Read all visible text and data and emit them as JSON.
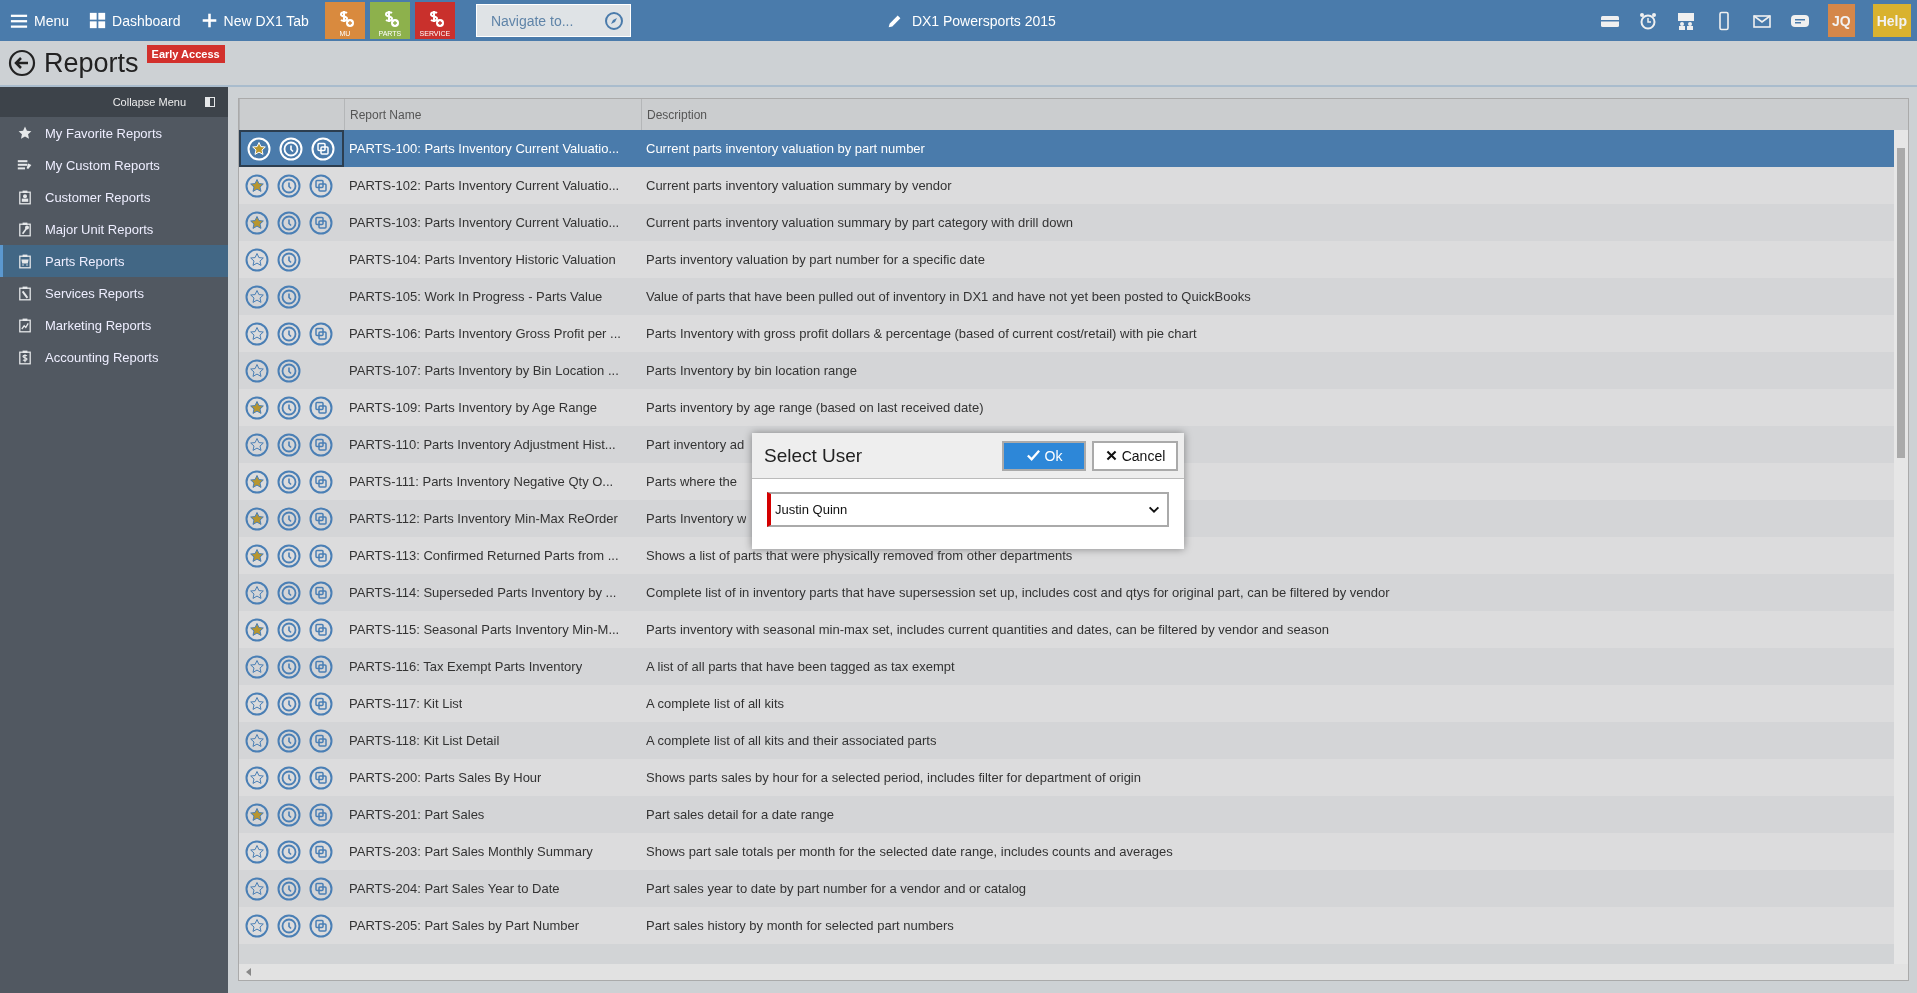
{
  "topbar": {
    "menu": "Menu",
    "dashboard": "Dashboard",
    "new_tab": "New DX1 Tab",
    "tiles": [
      {
        "label": "MU",
        "color": "#d98a3e"
      },
      {
        "label": "PARTS",
        "color": "#8db14c"
      },
      {
        "label": "SERVICE",
        "color": "#c9302c"
      }
    ],
    "navigate": {
      "placeholder": "Navigate to..."
    },
    "title": "DX1 Powersports 2015",
    "user": "JQ",
    "help": "Help"
  },
  "page": {
    "title": "Reports",
    "badge": "Early Access"
  },
  "sidebar": {
    "collapse": "Collapse Menu",
    "items": [
      {
        "label": "My Favorite Reports",
        "selected": false
      },
      {
        "label": "My Custom Reports",
        "selected": false
      },
      {
        "label": "Customer Reports",
        "selected": false
      },
      {
        "label": "Major Unit Reports",
        "selected": false
      },
      {
        "label": "Parts Reports",
        "selected": true
      },
      {
        "label": "Services Reports",
        "selected": false
      },
      {
        "label": "Marketing Reports",
        "selected": false
      },
      {
        "label": "Accounting Reports",
        "selected": false
      }
    ]
  },
  "table": {
    "columns": [
      "Report Name",
      "Description"
    ],
    "rows": [
      {
        "name": "PARTS-100: Parts Inventory Current Valuatio...",
        "description": "Current parts inventory valuation by part number",
        "favorite": true,
        "copy": true,
        "selected": true
      },
      {
        "name": "PARTS-102: Parts Inventory Current Valuatio...",
        "description": "Current parts inventory valuation summary by vendor",
        "favorite": true,
        "copy": true,
        "selected": false
      },
      {
        "name": "PARTS-103: Parts Inventory Current Valuatio...",
        "description": "Current parts inventory valuation summary by part category with drill down",
        "favorite": true,
        "copy": true,
        "selected": false
      },
      {
        "name": "PARTS-104: Parts Inventory Historic Valuation",
        "description": "Parts inventory valuation by part number for a specific date",
        "favorite": false,
        "copy": false,
        "selected": false
      },
      {
        "name": "PARTS-105: Work In Progress - Parts Value",
        "description": "Value of parts that have been pulled out of inventory in DX1 and have not yet been posted to QuickBooks",
        "favorite": false,
        "copy": false,
        "selected": false
      },
      {
        "name": "PARTS-106: Parts Inventory Gross Profit per ...",
        "description": "Parts Inventory with gross profit dollars & percentage (based of current cost/retail) with pie chart",
        "favorite": false,
        "copy": true,
        "selected": false
      },
      {
        "name": "PARTS-107: Parts Inventory by Bin Location ...",
        "description": "Parts Inventory by bin location range",
        "favorite": false,
        "copy": false,
        "selected": false
      },
      {
        "name": "PARTS-109: Parts Inventory by Age Range",
        "description": "Parts inventory by age range (based on last received date)",
        "favorite": true,
        "copy": true,
        "selected": false
      },
      {
        "name": "PARTS-110: Parts Inventory Adjustment Hist...",
        "description": "Part inventory ad",
        "favorite": false,
        "copy": true,
        "selected": false
      },
      {
        "name": "PARTS-111: Parts Inventory Negative Qty O...",
        "description": "Parts where the",
        "favorite": true,
        "copy": true,
        "selected": false
      },
      {
        "name": "PARTS-112: Parts Inventory Min-Max ReOrder",
        "description": "Parts Inventory w",
        "favorite": true,
        "copy": true,
        "selected": false
      },
      {
        "name": "PARTS-113: Confirmed Returned Parts from ...",
        "description": "Shows a list of parts that were physically removed from other departments",
        "favorite": true,
        "copy": true,
        "selected": false
      },
      {
        "name": "PARTS-114: Superseded Parts Inventory by ...",
        "description": "Complete list of in inventory parts that have supersession set up, includes cost and qtys for original part, can be filtered by vendor",
        "favorite": false,
        "copy": true,
        "selected": false
      },
      {
        "name": "PARTS-115: Seasonal Parts Inventory Min-M...",
        "description": "Parts inventory with seasonal min-max set, includes current quantities and dates, can be filtered by vendor and season",
        "favorite": true,
        "copy": true,
        "selected": false
      },
      {
        "name": "PARTS-116: Tax Exempt Parts Inventory",
        "description": "A list of all parts that have been tagged as tax exempt",
        "favorite": false,
        "copy": true,
        "selected": false
      },
      {
        "name": "PARTS-117: Kit List",
        "description": "A complete list of all kits",
        "favorite": false,
        "copy": true,
        "selected": false
      },
      {
        "name": "PARTS-118: Kit List Detail",
        "description": "A complete list of all kits and their associated parts",
        "favorite": false,
        "copy": true,
        "selected": false
      },
      {
        "name": "PARTS-200: Parts Sales By Hour",
        "description": "Shows parts sales by hour for a selected period, includes filter for department of origin",
        "favorite": false,
        "copy": true,
        "selected": false
      },
      {
        "name": "PARTS-201: Part Sales",
        "description": "Part sales detail for a date range",
        "favorite": true,
        "copy": true,
        "selected": false
      },
      {
        "name": "PARTS-203: Part Sales Monthly Summary",
        "description": "Shows part sale totals per month for the selected date range, includes counts and averages",
        "favorite": false,
        "copy": true,
        "selected": false
      },
      {
        "name": "PARTS-204: Part Sales Year to Date",
        "description": "Part sales year to date by part number for a vendor and or catalog",
        "favorite": false,
        "copy": true,
        "selected": false
      },
      {
        "name": "PARTS-205: Part Sales by Part Number",
        "description": "Part sales history by month for selected part numbers",
        "favorite": false,
        "copy": true,
        "selected": false
      }
    ]
  },
  "dialog": {
    "title": "Select User",
    "ok": "Ok",
    "cancel": "Cancel",
    "user": "Justin Quinn"
  }
}
